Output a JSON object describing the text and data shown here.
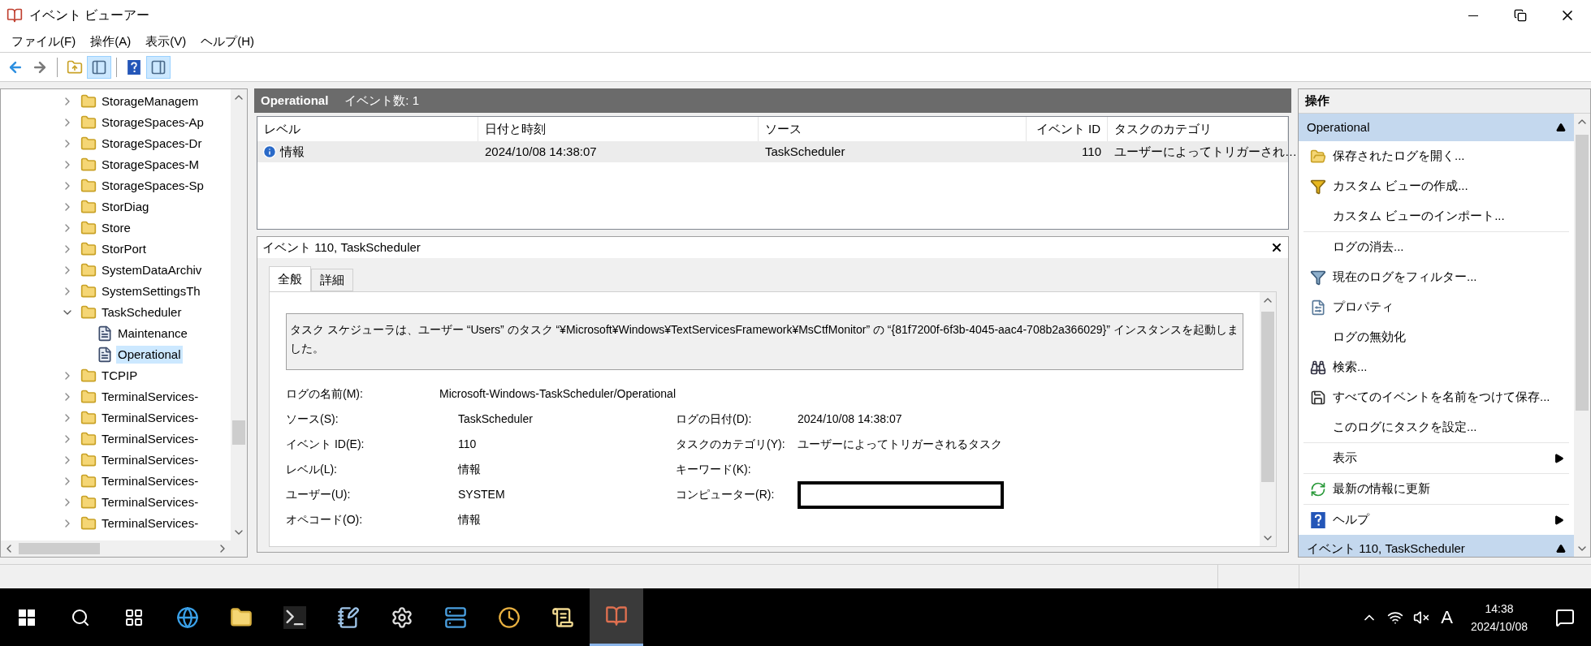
{
  "window": {
    "title": "イベント ビューアー"
  },
  "menu": [
    "ファイル(F)",
    "操作(A)",
    "表示(V)",
    "ヘルプ(H)"
  ],
  "toolbar": [
    [
      {
        "kind": "back",
        "pressed": false
      },
      {
        "kind": "forward",
        "pressed": false
      }
    ],
    [
      {
        "kind": "up",
        "pressed": false
      },
      {
        "kind": "tree-pane",
        "pressed": true
      }
    ],
    [
      {
        "kind": "help",
        "pressed": false
      },
      {
        "kind": "action-pane",
        "pressed": true
      }
    ]
  ],
  "tree": {
    "items": [
      {
        "label": "StorageManagem",
        "kind": "folder",
        "expanded": false,
        "selected": false
      },
      {
        "label": "StorageSpaces-Ap",
        "kind": "folder",
        "expanded": false,
        "selected": false
      },
      {
        "label": "StorageSpaces-Dr",
        "kind": "folder",
        "expanded": false,
        "selected": false
      },
      {
        "label": "StorageSpaces-M",
        "kind": "folder",
        "expanded": false,
        "selected": false
      },
      {
        "label": "StorageSpaces-Sp",
        "kind": "folder",
        "expanded": false,
        "selected": false
      },
      {
        "label": "StorDiag",
        "kind": "folder",
        "expanded": false,
        "selected": false
      },
      {
        "label": "Store",
        "kind": "folder",
        "expanded": false,
        "selected": false
      },
      {
        "label": "StorPort",
        "kind": "folder",
        "expanded": false,
        "selected": false
      },
      {
        "label": "SystemDataArchiv",
        "kind": "folder",
        "expanded": false,
        "selected": false
      },
      {
        "label": "SystemSettingsTh",
        "kind": "folder",
        "expanded": false,
        "selected": false
      },
      {
        "label": "TaskScheduler",
        "kind": "folder",
        "expanded": true,
        "selected": false,
        "children": [
          {
            "label": "Maintenance",
            "kind": "log",
            "selected": false
          },
          {
            "label": "Operational",
            "kind": "log",
            "selected": true
          }
        ]
      },
      {
        "label": "TCPIP",
        "kind": "folder",
        "expanded": false,
        "selected": false
      },
      {
        "label": "TerminalServices-",
        "kind": "folder",
        "expanded": false,
        "selected": false
      },
      {
        "label": "TerminalServices-",
        "kind": "folder",
        "expanded": false,
        "selected": false
      },
      {
        "label": "TerminalServices-",
        "kind": "folder",
        "expanded": false,
        "selected": false
      },
      {
        "label": "TerminalServices-",
        "kind": "folder",
        "expanded": false,
        "selected": false
      },
      {
        "label": "TerminalServices-",
        "kind": "folder",
        "expanded": false,
        "selected": false
      },
      {
        "label": "TerminalServices-",
        "kind": "folder",
        "expanded": false,
        "selected": false
      },
      {
        "label": "TerminalServices-",
        "kind": "folder",
        "expanded": false,
        "selected": false
      }
    ]
  },
  "log_header": {
    "name": "Operational",
    "count": "イベント数: 1"
  },
  "events": {
    "columns": [
      "レベル",
      "日付と時刻",
      "ソース",
      "イベント ID",
      "タスクのカテゴリ"
    ],
    "rows": [
      {
        "level": "情報",
        "kind": "info",
        "date": "2024/10/08 14:38:07",
        "source": "TaskScheduler",
        "event_id": "110",
        "category": "ユーザーによってトリガーされ…",
        "selected": true
      }
    ]
  },
  "detail": {
    "title": "イベント 110, TaskScheduler",
    "tabs": [
      {
        "label": "全般",
        "selected": true
      },
      {
        "label": "詳細",
        "selected": false
      }
    ],
    "message": "タスク スケジューラは、ユーザー “Users” のタスク “¥Microsoft¥Windows¥TextServicesFramework¥MsCtfMonitor” の “{81f7200f-6f3b-4045-aac4-708b2a366029}” インスタンスを起動しました。",
    "rows": [
      [
        {
          "label": "ログの名前(M):",
          "value": "Microsoft-Windows-TaskScheduler/Operational"
        }
      ],
      [
        {
          "label": "ソース(S):",
          "value": "TaskScheduler"
        },
        {
          "label": "ログの日付(D):",
          "value": "2024/10/08 14:38:07"
        }
      ],
      [
        {
          "label": "イベント ID(E):",
          "value": "110"
        },
        {
          "label": "タスクのカテゴリ(Y):",
          "value": "ユーザーによってトリガーされるタスク"
        }
      ],
      [
        {
          "label": "レベル(L):",
          "value": "情報"
        },
        {
          "label": "キーワード(K):"
        }
      ],
      [
        {
          "label": "ユーザー(U):",
          "value": "SYSTEM"
        },
        {
          "label": "コンピューター(R):",
          "redacted": true
        }
      ],
      [
        {
          "label": "オペコード(O):",
          "value": "情報"
        }
      ]
    ]
  },
  "actions": {
    "title": "操作",
    "sections": [
      {
        "title": "Operational",
        "expanded": true,
        "groups": [
          [
            {
              "label": "保存されたログを開く...",
              "kind": "open"
            },
            {
              "label": "カスタム ビューの作成...",
              "kind": "create-view"
            },
            {
              "label": "カスタム ビューのインポート...",
              "kind": "plain"
            }
          ],
          [
            {
              "label": "ログの消去...",
              "kind": "plain"
            },
            {
              "label": "現在のログをフィルター...",
              "kind": "filter"
            },
            {
              "label": "プロパティ",
              "kind": "properties"
            },
            {
              "label": "ログの無効化",
              "kind": "plain"
            },
            {
              "label": "検索...",
              "kind": "find"
            },
            {
              "label": "すべてのイベントを名前をつけて保存...",
              "kind": "save"
            },
            {
              "label": "このログにタスクを設定...",
              "kind": "plain"
            }
          ],
          [
            {
              "label": "表示",
              "kind": "plain",
              "submenu": true
            }
          ],
          [
            {
              "label": "最新の情報に更新",
              "kind": "refresh"
            }
          ],
          [
            {
              "label": "ヘルプ",
              "kind": "help",
              "submenu": true
            }
          ]
        ]
      },
      {
        "title": "イベント 110, TaskScheduler",
        "expanded": true
      }
    ]
  },
  "taskbar": {
    "apps": [
      {
        "kind": "start",
        "active": false
      },
      {
        "kind": "search",
        "active": false
      },
      {
        "kind": "task-view",
        "active": false
      },
      {
        "kind": "browser",
        "active": false
      },
      {
        "kind": "explorer",
        "active": false
      },
      {
        "kind": "terminal",
        "active": false
      },
      {
        "kind": "notepad",
        "active": false
      },
      {
        "kind": "gears",
        "active": false
      },
      {
        "kind": "server",
        "active": false
      },
      {
        "kind": "clock",
        "active": false
      },
      {
        "kind": "scroll",
        "active": false
      },
      {
        "kind": "event-viewer",
        "active": true
      }
    ],
    "tray": {
      "ime": "A",
      "time": "14:38",
      "date": "2024/10/08"
    }
  }
}
